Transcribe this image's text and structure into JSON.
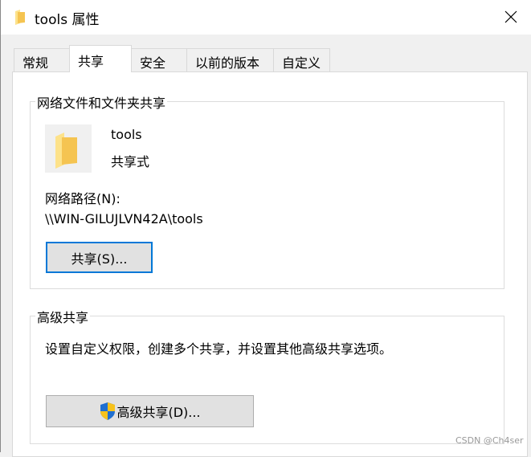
{
  "window": {
    "title": "tools 属性",
    "close_icon": "close-icon"
  },
  "tabs": [
    {
      "label": "常规"
    },
    {
      "label": "共享",
      "active": true
    },
    {
      "label": "安全"
    },
    {
      "label": "以前的版本"
    },
    {
      "label": "自定义"
    }
  ],
  "network_sharing": {
    "group_title": "网络文件和文件夹共享",
    "folder_name": "tools",
    "share_status": "共享式",
    "path_label": "网络路径(N):",
    "path_value": "\\\\WIN-GILUJLVN42A\\tools",
    "share_button": "共享(S)..."
  },
  "advanced_sharing": {
    "group_title": "高级共享",
    "description": "设置自定义权限，创建多个共享，并设置其他高级共享选项。",
    "button": "高级共享(D)...",
    "button_icon": "uac-shield-icon"
  },
  "watermark": "CSDN @Ch4ser",
  "colors": {
    "focus": "#0078d7",
    "folder": "#f5c451"
  }
}
